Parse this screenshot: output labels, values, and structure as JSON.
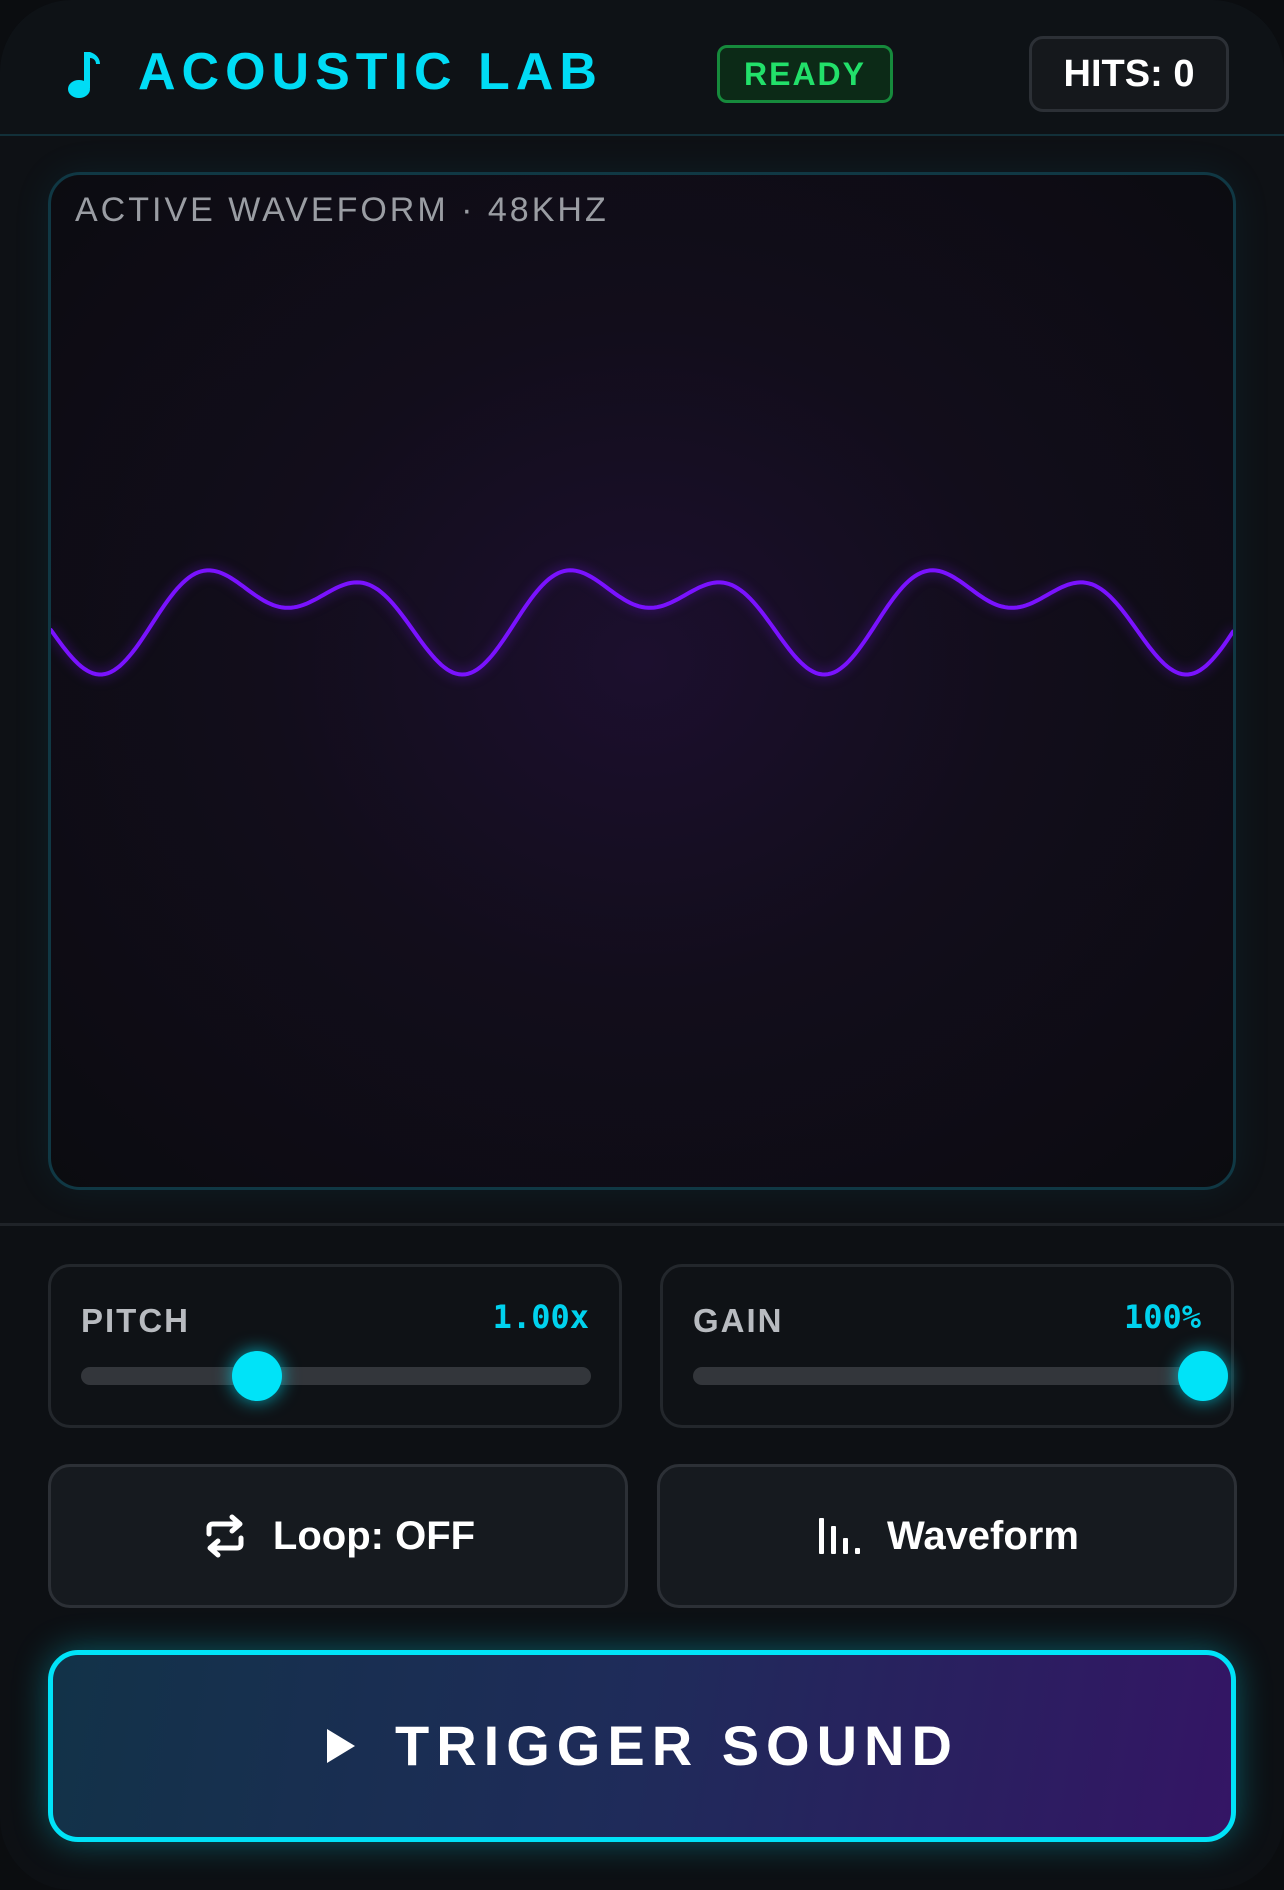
{
  "header": {
    "title": "ACOUSTIC LAB",
    "status": "READY",
    "hits_label": "HITS: 0",
    "logo_icon": "music-note-icon"
  },
  "visualizer": {
    "label": "ACTIVE WAVEFORM · 48KHZ",
    "wave_color": "#7a12ff"
  },
  "controls": {
    "pitch": {
      "label": "PITCH",
      "value_text": "1.00x",
      "level": 0.345
    },
    "gain": {
      "label": "GAIN",
      "value_text": "100%",
      "level": 1.0
    }
  },
  "buttons": {
    "loop": {
      "label": "Loop: OFF",
      "icon": "repeat-icon"
    },
    "waveform": {
      "label": "Waveform",
      "icon": "bar-chart-icon"
    },
    "trigger": {
      "label": "TRIGGER SOUND",
      "icon": "play-icon"
    }
  },
  "colors": {
    "accent": "#00e3f8",
    "status_green": "#22e06a",
    "wave": "#7a12ff"
  }
}
